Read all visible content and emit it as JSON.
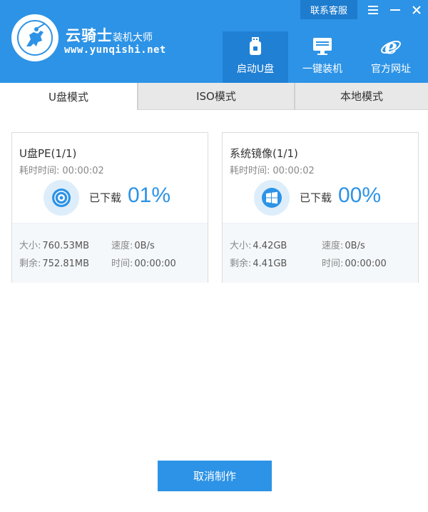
{
  "header": {
    "brand_name": "云骑士",
    "brand_suffix": "装机大师",
    "brand_url": "www.yunqishi.net",
    "contact_label": "联系客服",
    "menu_icon": "hamburger-icon",
    "minimize_icon": "minimize-icon",
    "close_icon": "close-icon",
    "nav": [
      {
        "label": "启动U盘",
        "icon": "usb-drive-icon",
        "active": true
      },
      {
        "label": "一键装机",
        "icon": "monitor-icon",
        "active": false
      },
      {
        "label": "官方网址",
        "icon": "ie-browser-icon",
        "active": false
      }
    ]
  },
  "tabs": [
    {
      "label": "U盘模式",
      "active": true
    },
    {
      "label": "ISO模式",
      "active": false
    },
    {
      "label": "本地模式",
      "active": false
    }
  ],
  "cards": [
    {
      "title": "U盘PE(1/1)",
      "elapsed_label": "耗时时间:",
      "elapsed_value": "00:00:02",
      "status_label": "已下载",
      "percent": "01%",
      "progress": 0.01,
      "icon": "disc-icon",
      "size_label": "大小:",
      "size_value": "760.53MB",
      "speed_label": "速度:",
      "speed_value": "0B/s",
      "remaining_label": "剩余:",
      "remaining_value": "752.81MB",
      "time_label": "时间:",
      "time_value": "00:00:00"
    },
    {
      "title": "系统镜像(1/1)",
      "elapsed_label": "耗时时间:",
      "elapsed_value": "00:00:02",
      "status_label": "已下载",
      "percent": "00%",
      "progress": 0.0,
      "icon": "windows-logo-icon",
      "size_label": "大小:",
      "size_value": "4.42GB",
      "speed_label": "速度:",
      "speed_value": "0B/s",
      "remaining_label": "剩余:",
      "remaining_value": "4.41GB",
      "time_label": "时间:",
      "time_value": "00:00:00"
    }
  ],
  "footer": {
    "cancel_label": "取消制作"
  },
  "colors": {
    "primary": "#2d93e6",
    "primary_dark": "#1e7ccf",
    "nav_active": "#2080d4",
    "tab_inactive": "#e8e8e8",
    "icon_bg": "#ddeefa"
  }
}
